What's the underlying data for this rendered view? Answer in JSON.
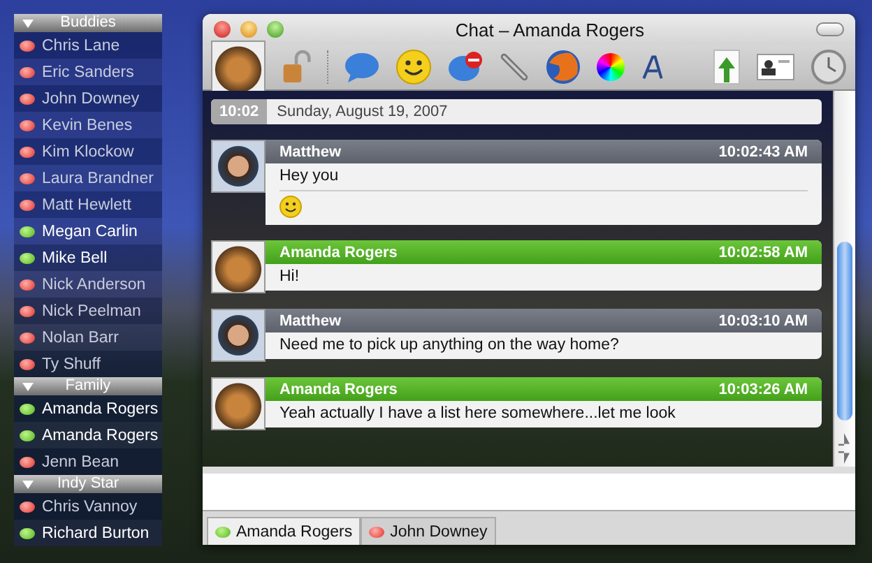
{
  "buddy_list": {
    "groups": [
      {
        "name": "Buddies",
        "expanded": true,
        "buddies": [
          {
            "name": "Chris Lane",
            "online": false
          },
          {
            "name": "Eric Sanders",
            "online": false
          },
          {
            "name": "John Downey",
            "online": false
          },
          {
            "name": "Kevin Benes",
            "online": false
          },
          {
            "name": "Kim Klockow",
            "online": false
          },
          {
            "name": "Laura Brandner",
            "online": false
          },
          {
            "name": "Matt Hewlett",
            "online": false
          },
          {
            "name": "Megan Carlin",
            "online": true
          },
          {
            "name": "Mike Bell",
            "online": true
          },
          {
            "name": "Nick Anderson",
            "online": false
          },
          {
            "name": "Nick Peelman",
            "online": false
          },
          {
            "name": "Nolan Barr",
            "online": false
          },
          {
            "name": "Ty Shuff",
            "online": false
          }
        ]
      },
      {
        "name": "Family",
        "expanded": true,
        "buddies": [
          {
            "name": "Amanda Rogers",
            "online": true
          },
          {
            "name": "Amanda Rogers",
            "online": true
          },
          {
            "name": "Jenn Bean",
            "online": false
          }
        ]
      },
      {
        "name": "Indy Star",
        "expanded": true,
        "buddies": [
          {
            "name": "Chris Vannoy",
            "online": false
          },
          {
            "name": "Richard Burton",
            "online": true
          }
        ]
      }
    ]
  },
  "window": {
    "title": "Chat – Amanda Rogers"
  },
  "date_bar": {
    "time": "10:02",
    "date": "Sunday, August 19, 2007"
  },
  "messages": [
    {
      "sender": "Matthew",
      "kind": "outgoing",
      "time": "10:02:43 AM",
      "text": "Hey you",
      "smiley": true
    },
    {
      "sender": "Amanda Rogers",
      "kind": "incoming",
      "time": "10:02:58 AM",
      "text": "Hi!",
      "smiley": false
    },
    {
      "sender": "Matthew",
      "kind": "outgoing",
      "time": "10:03:10 AM",
      "text": "Need me to pick up anything on the way home?",
      "smiley": false
    },
    {
      "sender": "Amanda Rogers",
      "kind": "incoming",
      "time": "10:03:26 AM",
      "text": "Yeah actually I have a list here somewhere...let me look",
      "smiley": false
    }
  ],
  "tabs": [
    {
      "label": "Amanda Rogers",
      "selected": true,
      "online": true
    },
    {
      "label": "John Downey",
      "selected": false,
      "online": false
    }
  ]
}
